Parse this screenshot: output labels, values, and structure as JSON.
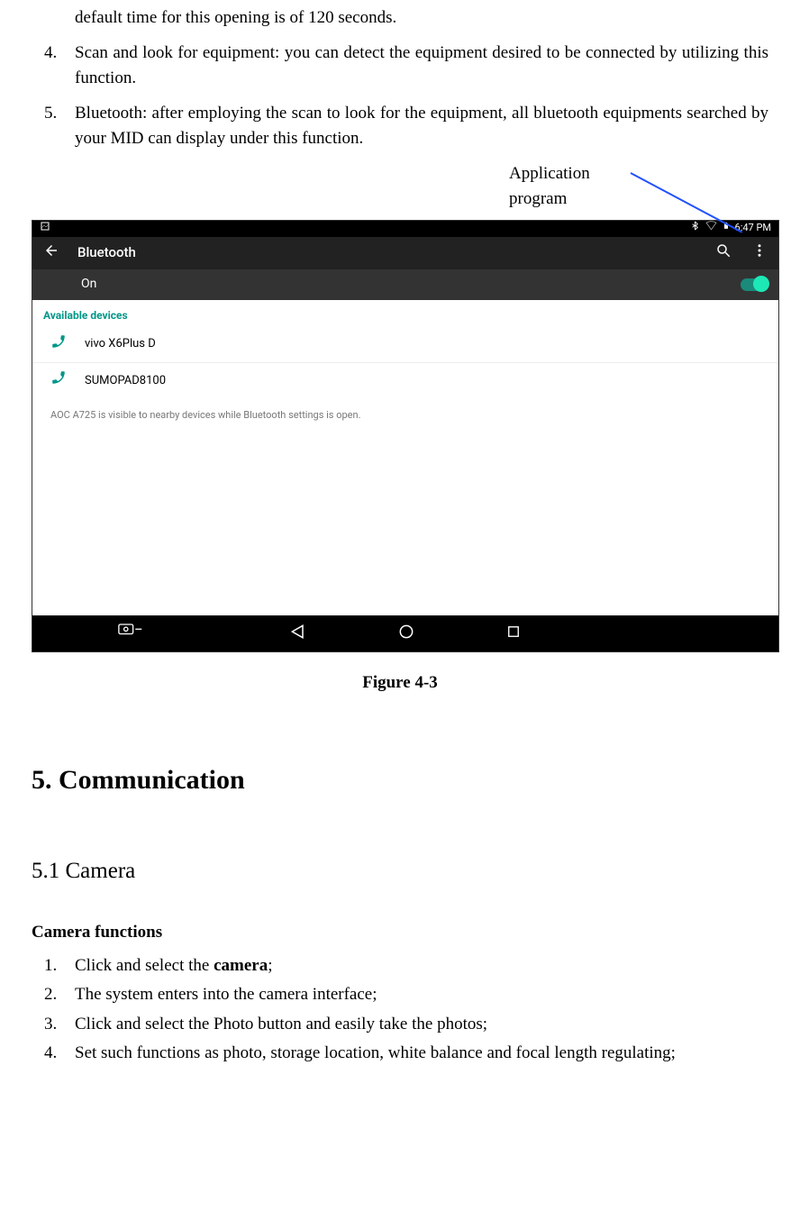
{
  "intro_text": "default time for this opening is of 120 seconds.",
  "list": [
    {
      "num": "4.",
      "text": "Scan and look for equipment: you can detect the equipment desired to be connected by utilizing this function."
    },
    {
      "num": "5.",
      "text": "Bluetooth: after employing the scan to look for the equipment, all bluetooth equipments searched by your MID can display under this function."
    }
  ],
  "annotation": {
    "line1": "Application",
    "line2": "program"
  },
  "screenshot": {
    "status_time": "6:47 PM",
    "appbar_title": "Bluetooth",
    "toggle_label": "On",
    "section_header": "Available devices",
    "devices": [
      {
        "name": "vivo X6Plus D"
      },
      {
        "name": "SUMOPAD8100"
      }
    ],
    "visibility_note": "AOC A725 is visible to nearby devices while Bluetooth settings is open."
  },
  "figure_caption": "Figure 4-3",
  "main_heading": "5. Communication",
  "sub_heading": "5.1 Camera",
  "camera": {
    "title": "Camera functions",
    "items": [
      {
        "num": "1.",
        "pre": "Click and select the ",
        "bold": "camera",
        "post": ";"
      },
      {
        "num": "2.",
        "pre": "The system enters into the camera interface;",
        "bold": "",
        "post": ""
      },
      {
        "num": "3.",
        "pre": "Click and select the Photo button and easily take the photos;",
        "bold": "",
        "post": ""
      },
      {
        "num": "4.",
        "pre": "Set such functions as photo, storage location, white balance and focal length regulating;",
        "bold": "",
        "post": ""
      }
    ]
  }
}
